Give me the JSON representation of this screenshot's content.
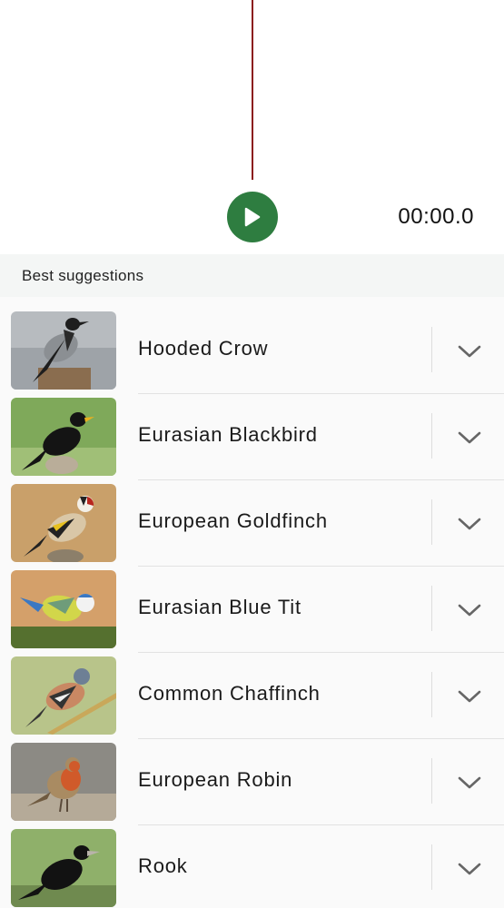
{
  "player": {
    "timer": "00:00.0",
    "play_icon": "play-icon",
    "accent_color": "#2e7d40",
    "playhead_color": "#8b1a1a"
  },
  "suggestions": {
    "header": "Best suggestions",
    "items": [
      {
        "name": "Hooded Crow",
        "image": "hooded-crow-photo"
      },
      {
        "name": "Eurasian Blackbird",
        "image": "eurasian-blackbird-photo"
      },
      {
        "name": "European Goldfinch",
        "image": "european-goldfinch-photo"
      },
      {
        "name": "Eurasian Blue Tit",
        "image": "eurasian-blue-tit-photo"
      },
      {
        "name": "Common Chaffinch",
        "image": "common-chaffinch-photo"
      },
      {
        "name": "European Robin",
        "image": "european-robin-photo"
      },
      {
        "name": "Rook",
        "image": "rook-photo"
      }
    ],
    "expand_icon": "chevron-down-icon"
  }
}
